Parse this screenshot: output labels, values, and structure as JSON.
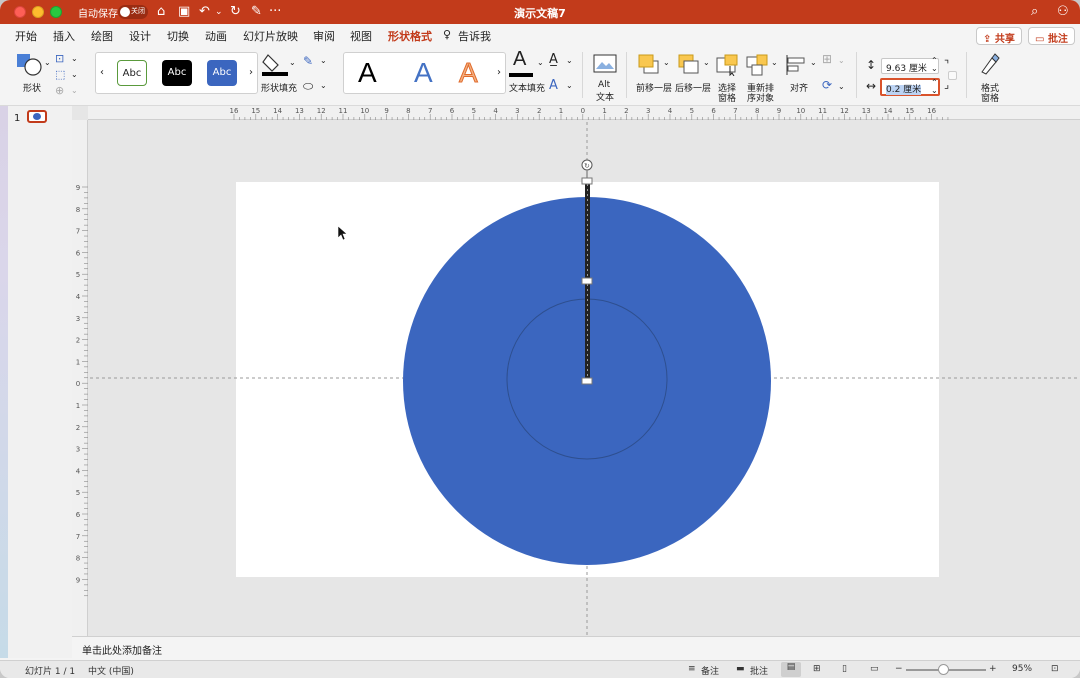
{
  "titlebar": {
    "autosave_label": "自动保存",
    "toggle_label": "关闭",
    "doc_title": "演示文稿7"
  },
  "menu": {
    "tabs": [
      "开始",
      "插入",
      "绘图",
      "设计",
      "切换",
      "动画",
      "幻灯片放映",
      "审阅",
      "视图",
      "形状格式",
      "告诉我"
    ],
    "active_tab": "形状格式",
    "share_label": "共享",
    "comment_label": "批注"
  },
  "ribbon": {
    "shape_label": "形状",
    "style_swatches": [
      "Abc",
      "Abc",
      "Abc"
    ],
    "shape_fill_label": "形状填充",
    "wordart_letters": [
      "A",
      "A",
      "A"
    ],
    "text_fill_label": "文本填充",
    "alt_text_label_1": "Alt",
    "alt_text_label_2": "文本",
    "bring_forward_label": "前移一层",
    "send_backward_label": "后移一层",
    "selection_pane_label_1": "选择",
    "selection_pane_label_2": "窗格",
    "reorder_label_1": "重新排",
    "reorder_label_2": "序对象",
    "align_label": "对齐",
    "height_value": "9.63 厘米",
    "width_value": "0.2 厘米",
    "format_pane_label_1": "格式",
    "format_pane_label_2": "窗格"
  },
  "slides_panel": {
    "slide_number": "1"
  },
  "ruler": {
    "h_labels": [
      "16",
      "15",
      "14",
      "13",
      "12",
      "11",
      "10",
      "9",
      "8",
      "7",
      "6",
      "5",
      "4",
      "3",
      "2",
      "1",
      "0",
      "1",
      "2",
      "3",
      "4",
      "5",
      "6",
      "7",
      "8",
      "9",
      "10",
      "11",
      "12",
      "13",
      "14",
      "15",
      "16"
    ],
    "v_labels": [
      "9",
      "8",
      "7",
      "6",
      "5",
      "4",
      "3",
      "2",
      "1",
      "0",
      "1",
      "2",
      "3",
      "4",
      "5",
      "6",
      "7",
      "8",
      "9"
    ]
  },
  "colors": {
    "accent": "#c23b1b",
    "circle_fill": "#3b66bf",
    "circle_stroke": "#2e4f8f"
  },
  "notes": {
    "placeholder": "单击此处添加备注"
  },
  "status": {
    "slide_count": "幻灯片 1 / 1",
    "language": "中文 (中国)",
    "notes_label": "备注",
    "comments_label": "批注",
    "zoom": "95%"
  }
}
